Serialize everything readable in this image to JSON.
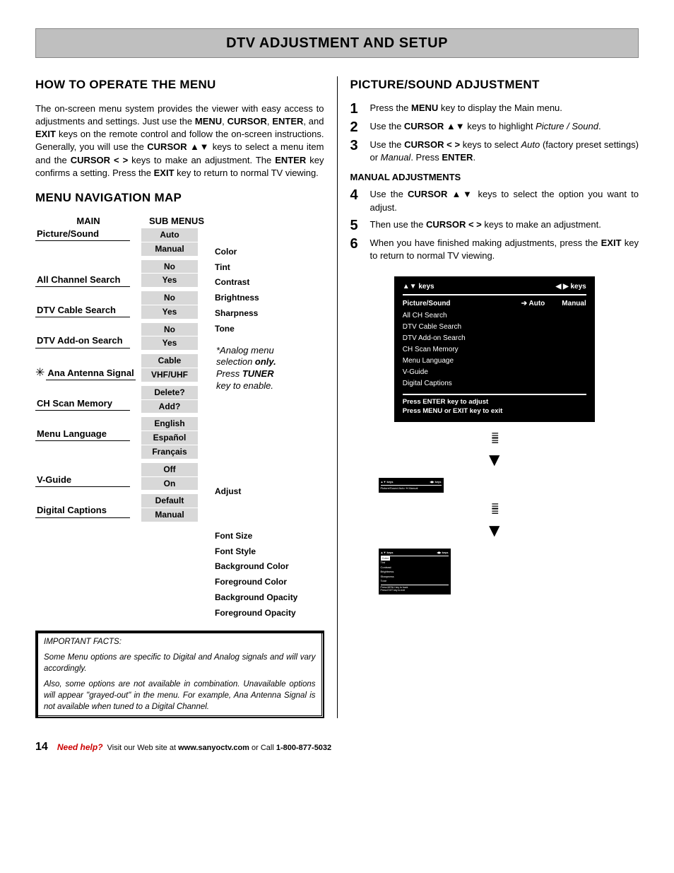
{
  "banner": "DTV ADJUSTMENT AND SETUP",
  "left": {
    "h1": "HOW TO OPERATE THE MENU",
    "intro_pre": "The on-screen menu system provides the viewer with easy access to adjustments and settings. Just use the ",
    "intro_keys": [
      "MENU",
      "CURSOR",
      "ENTER",
      "EXIT"
    ],
    "intro_mid1": " keys on the remote control and follow the on-screen instructions. Generally, you will use the ",
    "intro_cursor_ud": "CURSOR ▲▼",
    "intro_mid2": " keys to select a menu item and the ",
    "intro_cursor_lr": "CURSOR < >",
    "intro_mid3": " keys to make an adjustment. The ",
    "intro_enter": "ENTER",
    "intro_mid4": " key confirms a setting. Press the ",
    "intro_exit": "EXIT",
    "intro_end": " key to return to normal TV viewing.",
    "h2": "MENU NAVIGATION MAP",
    "hdr_main": "MAIN",
    "hdr_sub": "SUB MENUS",
    "map": {
      "picture_sound": "Picture/Sound",
      "auto": "Auto",
      "manual": "Manual",
      "color": "Color",
      "tint": "Tint",
      "contrast": "Contrast",
      "brightness": "Brightness",
      "sharpness": "Sharpness",
      "tone": "Tone",
      "all_ch": "All Channel Search",
      "no": "No",
      "yes": "Yes",
      "dtv_cable": "DTV Cable Search",
      "dtv_addon": "DTV Add-on Search",
      "ana": "Ana Antenna Signal",
      "cable": "Cable",
      "vhfuhf": "VHF/UHF",
      "chscan": "CH Scan Memory",
      "delete": "Delete?",
      "add": "Add?",
      "menulang": "Menu Language",
      "english": "English",
      "espanol": "Español",
      "francais": "Français",
      "vguide": "V-Guide",
      "off": "Off",
      "on": "On",
      "adjust": "Adjust",
      "digcap": "Digital Captions",
      "default": "Default",
      "fontsize": "Font Size",
      "fontstyle": "Font Style",
      "bgcolor": "Background Color",
      "fgcolor": "Foreground Color",
      "bgop": "Background Opacity",
      "fgop": "Foreground Opacity"
    },
    "analog_note_l1": "*Analog menu",
    "analog_note_l2a": "selection ",
    "analog_note_l2b": "only.",
    "analog_note_l3a": "Press ",
    "analog_note_l3b": "TUNER",
    "analog_note_l4": "key to enable.",
    "facts_title": "IMPORTANT FACTS:",
    "facts_p1": "Some Menu options are specific to Digital and Analog signals and will vary accordingly.",
    "facts_p2": "Also, some options are not available in combination. Unavailable options will appear \"grayed-out\" in the menu. For example, Ana Antenna Signal is not available when tuned to a Digital Channel."
  },
  "right": {
    "h1": "PICTURE/SOUND ADJUSTMENT",
    "s1a": "Press the ",
    "s1b": "MENU",
    "s1c": " key to display the Main menu.",
    "s2a": "Use the ",
    "s2b": "CURSOR ▲▼",
    "s2c": " keys to highlight ",
    "s2d": "Picture / Sound",
    "s2e": ".",
    "s3a": "Use the ",
    "s3b": "CURSOR < >",
    "s3c": " keys to select ",
    "s3d": "Auto",
    "s3e": " (factory preset settings) or ",
    "s3f": "Manual",
    "s3g": ". Press ",
    "s3h": "ENTER",
    "s3i": ".",
    "sub": "MANUAL ADJUSTMENTS",
    "s4a": "Use the ",
    "s4b": "CURSOR ▲▼",
    "s4c": " keys to select the option you want to adjust.",
    "s5a": "Then use the ",
    "s5b": "CURSOR < >",
    "s5c": " keys to make an adjustment.",
    "s6a": "When you have finished making adjustments, press the ",
    "s6b": "EXIT",
    "s6c": " key to return to normal TV viewing.",
    "osd": {
      "top_l": "▲▼ keys",
      "top_r": "◀ ▶ keys",
      "row1_a": "Picture/Sound",
      "row1_b": "➔ Auto",
      "row1_c": "Manual",
      "items": [
        "All CH Search",
        "DTV Cable Search",
        "DTV Add-on Search",
        "CH Scan Memory",
        "Menu Language",
        "V-Guide",
        "Digital Captions"
      ],
      "bot1": "Press ENTER key to adjust",
      "bot2": "Press MENU or EXIT key to exit"
    },
    "mini1": {
      "hdr_l": "▲▼ keys",
      "hdr_r": "◀▶ keys",
      "l1": "Picture/Sound    Auto ➔ Manual"
    },
    "mini2": {
      "hdr_l": "▲▼ keys",
      "hdr_r": "◀▶ keys",
      "lines": [
        "Color",
        "Tint",
        "Contrast",
        "Brightness",
        "Sharpness",
        "Tone"
      ],
      "ft1": "Press MENU key to back",
      "ft2": "Press EXIT key to exit"
    }
  },
  "footer": {
    "page": "14",
    "need": "Need help?",
    "rest1": " Visit our Web site at ",
    "url": "www.sanyoctv.com",
    "rest2": " or Call ",
    "phone": "1-800-877-5032"
  }
}
